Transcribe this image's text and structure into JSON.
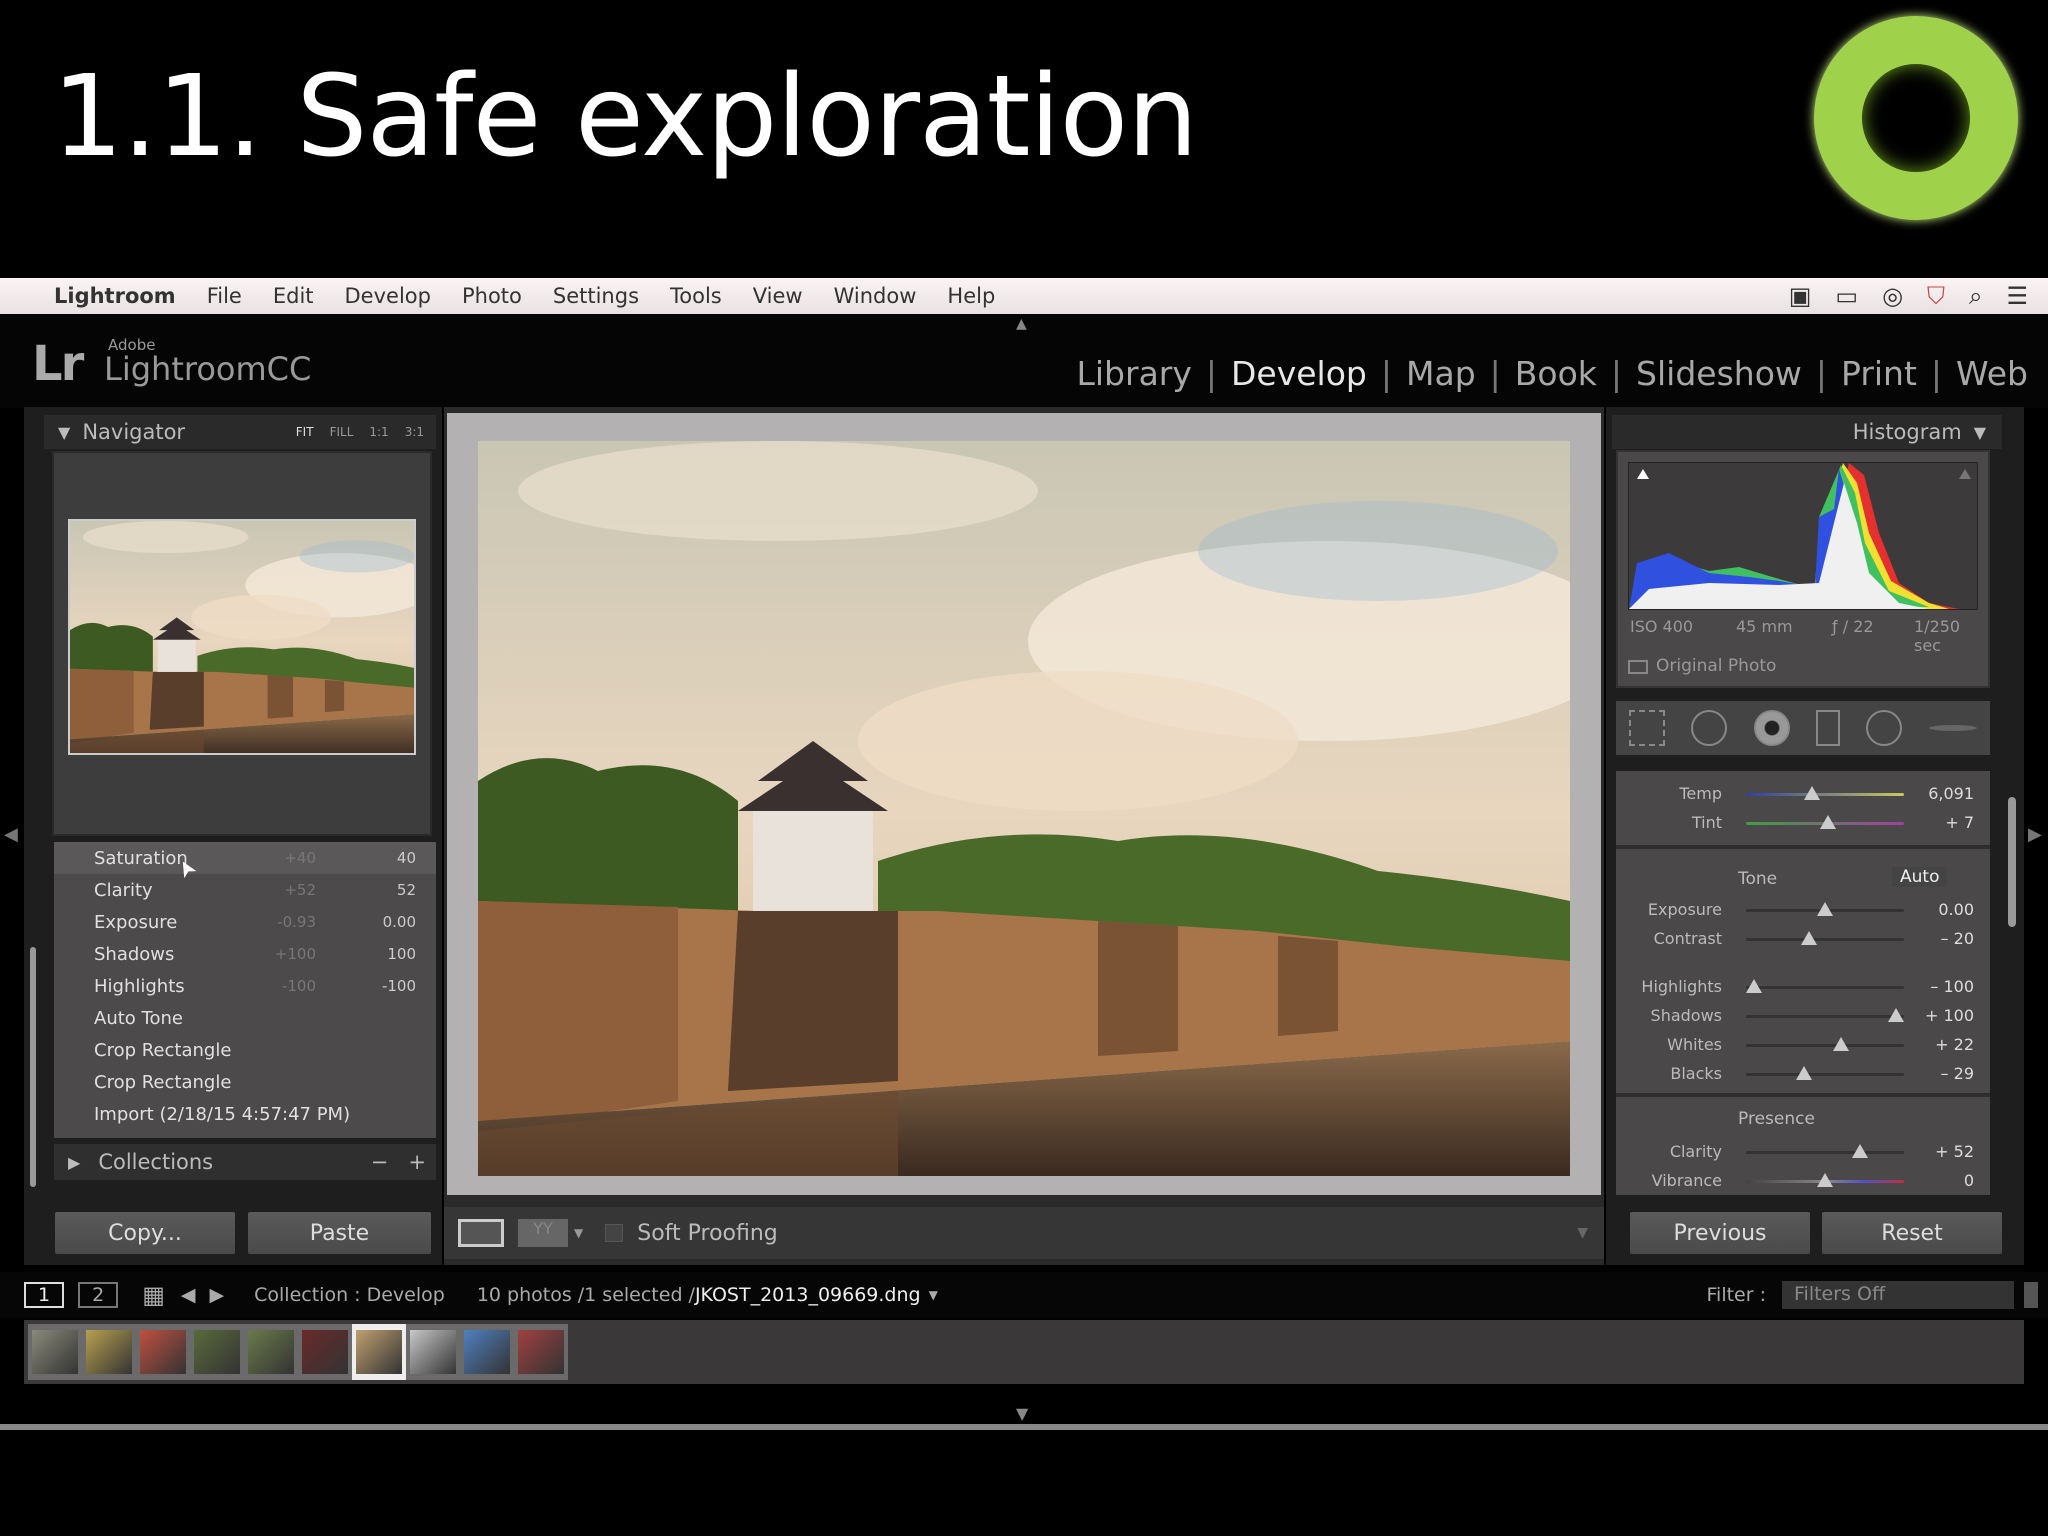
{
  "slide": {
    "title": "1.1. Safe exploration"
  },
  "menubar": {
    "app": "Lightroom",
    "items": [
      "File",
      "Edit",
      "Develop",
      "Photo",
      "Settings",
      "Tools",
      "View",
      "Window",
      "Help"
    ]
  },
  "header": {
    "logo": "Lr",
    "adobe": "Adobe",
    "product": "LightroomCC",
    "modules": [
      "Library",
      "Develop",
      "Map",
      "Book",
      "Slideshow",
      "Print",
      "Web"
    ],
    "active_module": "Develop"
  },
  "navigator": {
    "title": "Navigator",
    "zoom_options": [
      "FIT",
      "FILL",
      "1:1",
      "3:1"
    ]
  },
  "history": [
    {
      "label": "Saturation",
      "before": "+40",
      "after": "40"
    },
    {
      "label": "Clarity",
      "before": "+52",
      "after": "52"
    },
    {
      "label": "Exposure",
      "before": "-0.93",
      "after": "0.00"
    },
    {
      "label": "Shadows",
      "before": "+100",
      "after": "100"
    },
    {
      "label": "Highlights",
      "before": "-100",
      "after": "-100"
    },
    {
      "label": "Auto Tone",
      "before": "",
      "after": ""
    },
    {
      "label": "Crop Rectangle",
      "before": "",
      "after": ""
    },
    {
      "label": "Crop Rectangle",
      "before": "",
      "after": ""
    },
    {
      "label": "Import (2/18/15 4:57:47 PM)",
      "before": "",
      "after": ""
    }
  ],
  "collections": {
    "title": "Collections",
    "minus": "−",
    "plus": "+"
  },
  "left_buttons": {
    "copy": "Copy...",
    "paste": "Paste"
  },
  "center_toolbar": {
    "soft_proofing": "Soft Proofing"
  },
  "histogram": {
    "title": "Histogram",
    "iso": "ISO 400",
    "focal": "45 mm",
    "aperture": "ƒ / 22",
    "shutter": "1/250 sec",
    "original_photo": "Original Photo"
  },
  "basic": {
    "wb": [
      {
        "label": "Temp",
        "value": "6,091",
        "pos": 0.42
      },
      {
        "label": "Tint",
        "value": "+ 7",
        "pos": 0.52
      }
    ],
    "tone_title": "Tone",
    "auto": "Auto",
    "tone": [
      {
        "label": "Exposure",
        "value": "0.00",
        "pos": 0.5
      },
      {
        "label": "Contrast",
        "value": "– 20",
        "pos": 0.4
      }
    ],
    "tone2": [
      {
        "label": "Highlights",
        "value": "– 100",
        "pos": 0.05
      },
      {
        "label": "Shadows",
        "value": "+ 100",
        "pos": 0.95
      },
      {
        "label": "Whites",
        "value": "+ 22",
        "pos": 0.6
      },
      {
        "label": "Blacks",
        "value": "– 29",
        "pos": 0.37
      }
    ],
    "presence_title": "Presence",
    "presence": [
      {
        "label": "Clarity",
        "value": "+ 52",
        "pos": 0.72
      },
      {
        "label": "Vibrance",
        "value": "0",
        "pos": 0.5
      }
    ]
  },
  "right_buttons": {
    "previous": "Previous",
    "reset": "Reset"
  },
  "filmbar": {
    "view1": "1",
    "view2": "2",
    "collection": "Collection : Develop",
    "count": "10 photos /1 selected /",
    "filename": "JKOST_2013_09669.dng",
    "filter_label": "Filter :",
    "filter_value": "Filters Off"
  },
  "filmstrip": {
    "count": 10,
    "selected_index": 6,
    "colors": [
      "#8a8a7a",
      "#b8a050",
      "#c05040",
      "#5a6a3a",
      "#6a7a4a",
      "#6a2a2a",
      "#c0a070",
      "#c8c8c8",
      "#5080c0",
      "#a04040"
    ]
  }
}
